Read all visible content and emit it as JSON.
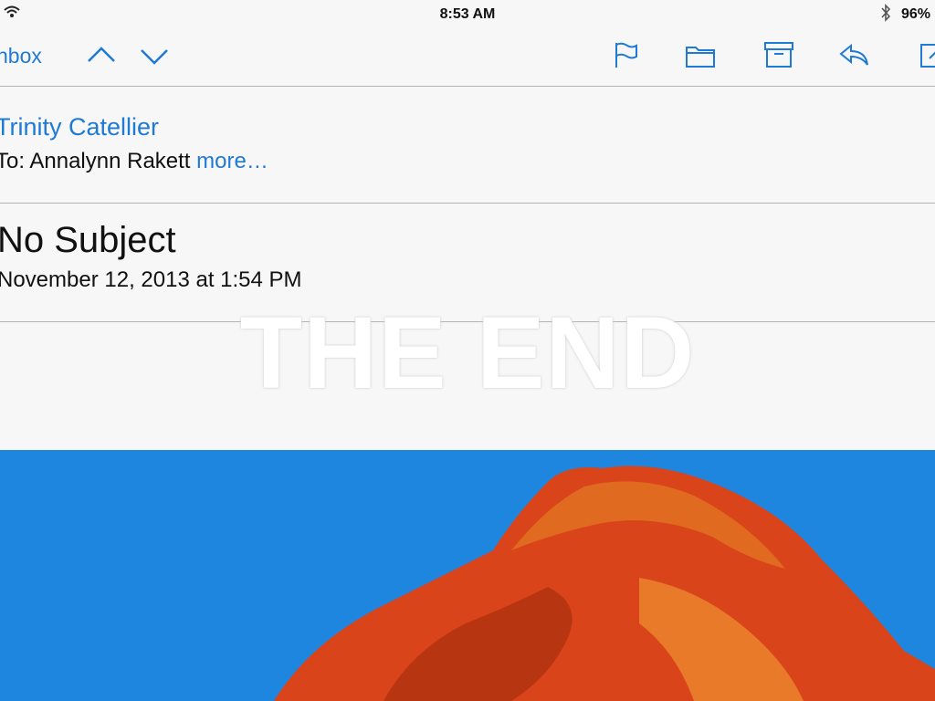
{
  "status_bar": {
    "time": "8:53 AM",
    "battery": "96%",
    "wifi_icon": "wifi-icon",
    "bluetooth_icon": "bluetooth-icon"
  },
  "toolbar": {
    "back_label": "nbox",
    "icons": [
      "chevron-up-icon",
      "chevron-down-icon",
      "flag-icon",
      "folder-icon",
      "archive-icon",
      "reply-icon",
      "compose-icon"
    ],
    "accent_color": "#1f7ad6"
  },
  "message": {
    "sender": "Trinity Catellier",
    "to_prefix": "To: Annalynn Rakett",
    "more_label": "more…",
    "subject": "No Subject",
    "date": "November 12, 2013 at 1:54 PM"
  },
  "overlay": {
    "text": "THE END"
  },
  "photo": {
    "background_color": "#1f86e0",
    "subject_color": "#d9441a"
  }
}
